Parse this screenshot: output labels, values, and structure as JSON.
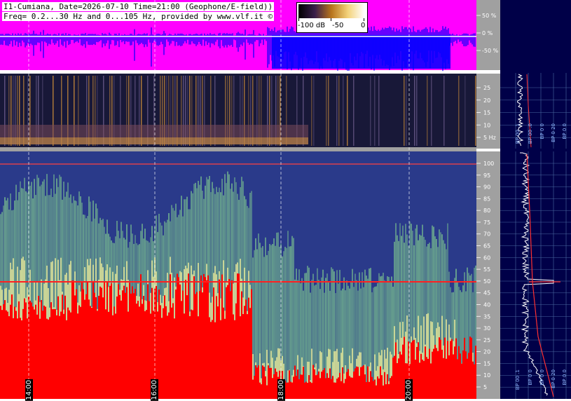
{
  "header": {
    "line1": "I1-Cumiana, Date=2026-07-10 Time=21:00 (Geophone/E-field))",
    "line2": "Freq= 0.2...30 Hz and 0...105 Hz, provided by www.vlf.it ©"
  },
  "colorbar": {
    "labels": [
      "-100 dB",
      "-50",
      "0"
    ],
    "colors": [
      "#000000",
      "#3a1e4a",
      "#b8741c",
      "#f3d27a",
      "#ffffff"
    ]
  },
  "chart_data": [
    {
      "type": "area",
      "title": "",
      "ylabel": "",
      "y_ticks": [
        "50 %",
        "0 %",
        "-50 %"
      ],
      "ylim": [
        -100,
        100
      ],
      "colors": {
        "background": "#ff00ff",
        "trace": "#0000ff",
        "center": "#ffffff"
      }
    },
    {
      "type": "heatmap",
      "title": "",
      "y_ticks": [
        "25",
        "20",
        "15",
        "10",
        "5 Hz"
      ],
      "ylim": [
        0.2,
        30
      ],
      "colors": {
        "low": "#0b0b30",
        "high": "#f3c070"
      }
    },
    {
      "type": "heatmap",
      "title": "",
      "y_ticks": [
        "100",
        "95",
        "90",
        "85",
        "80",
        "75",
        "70",
        "65",
        "60",
        "55",
        "50",
        "45",
        "40",
        "35",
        "30",
        "25",
        "20",
        "15",
        "10",
        "5"
      ],
      "ylim": [
        0,
        105
      ],
      "x_ticks": [
        "14:00",
        "16:00",
        "18:00",
        "20:00"
      ],
      "colors": {
        "low": "#1e2a7a",
        "mid": "#6fae8e",
        "high": "#f6f29a",
        "max": "#ff0000"
      }
    }
  ],
  "side_panels": {
    "upper_axis": [
      "BP 00 .1",
      "BP 00 .0",
      "BP 0 0",
      "BP 0 20",
      "BP 0 0"
    ],
    "lower_axis": [
      "BP 00 .1",
      "BP 0 0",
      "BP 0 0",
      "BP 0 20",
      "BP 0 0"
    ]
  }
}
